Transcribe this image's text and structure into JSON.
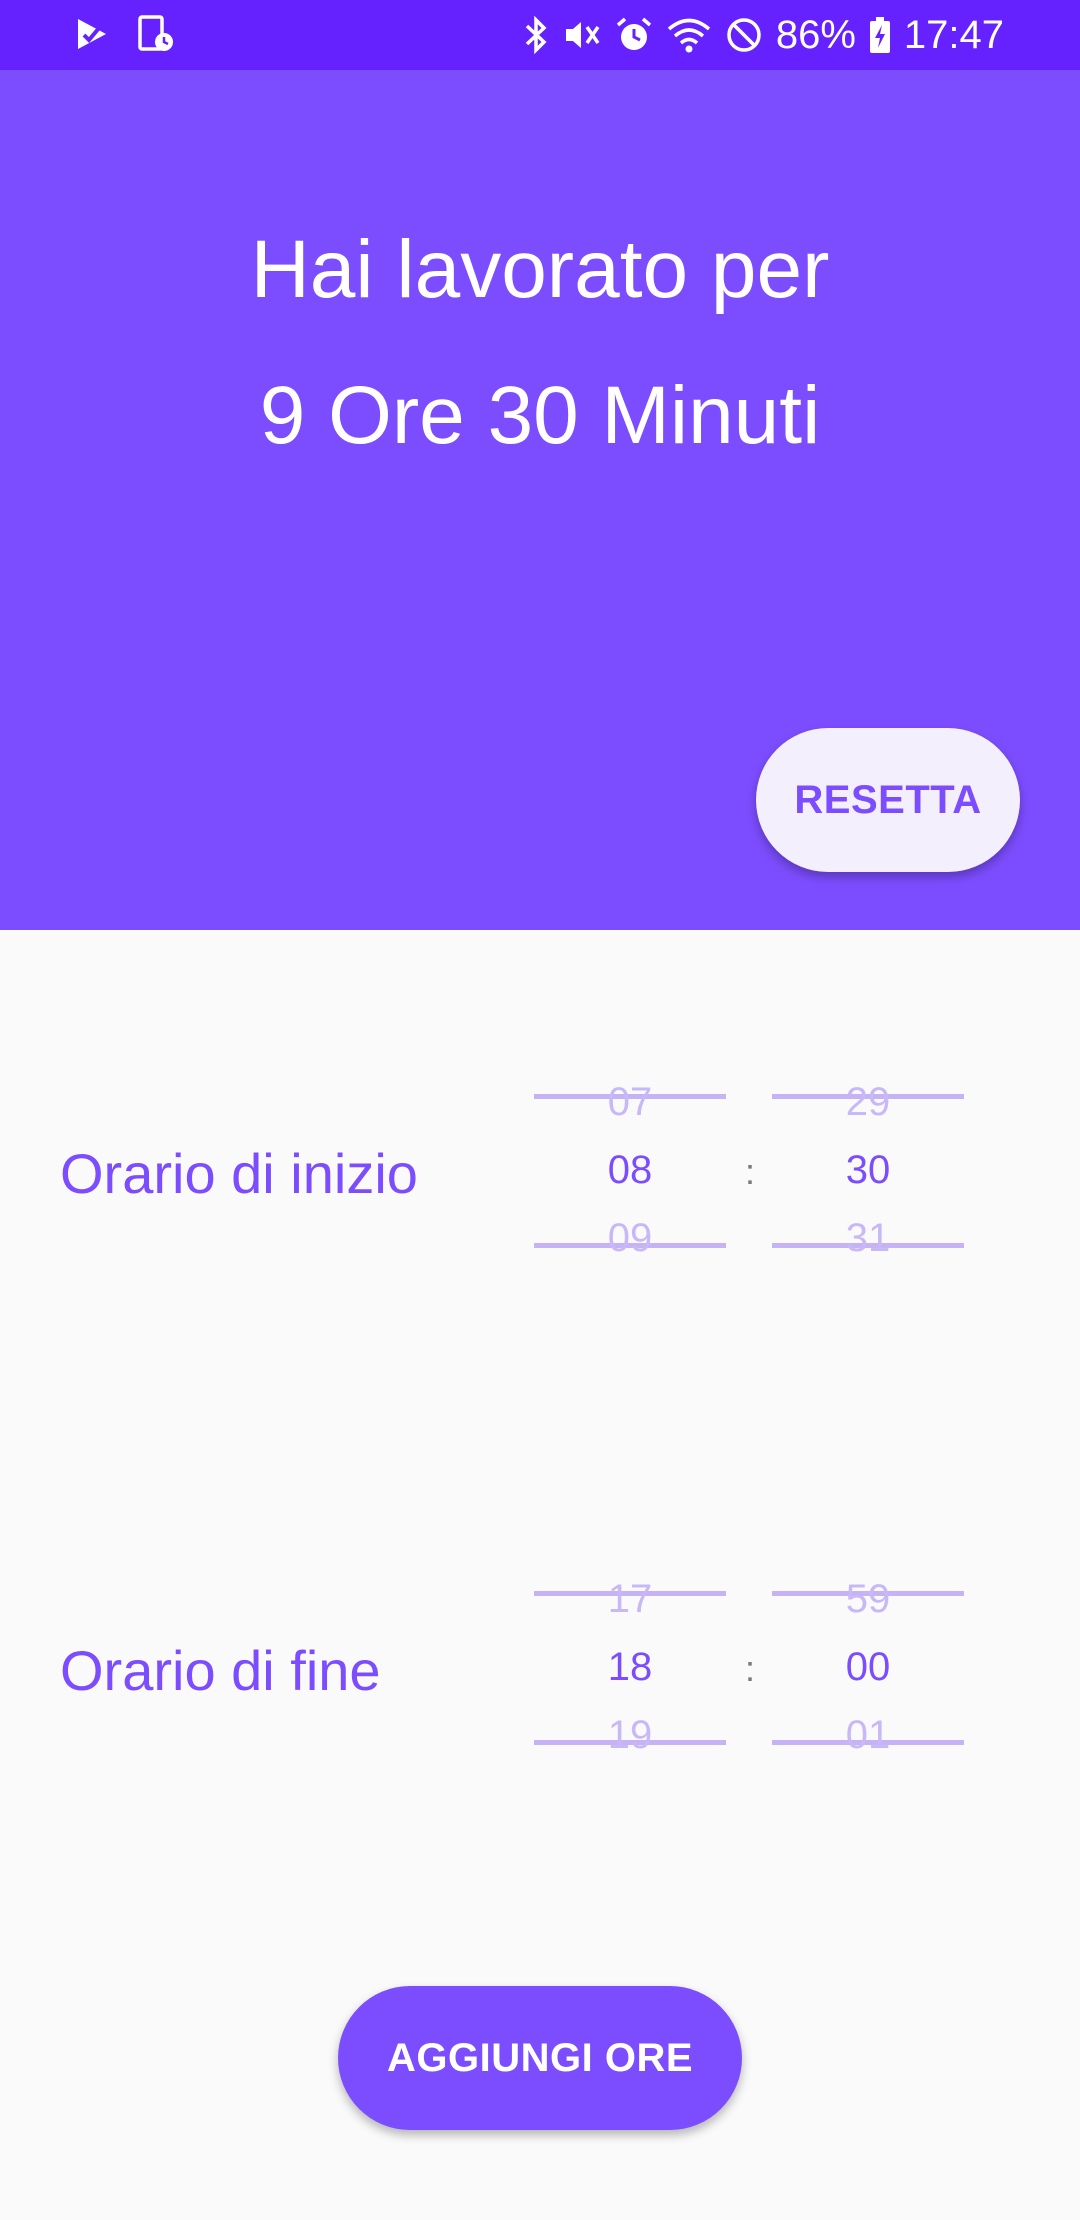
{
  "status_bar": {
    "left_icons": [
      "play-store-check-icon",
      "screen-timer-icon"
    ],
    "right_icons": [
      "bluetooth-icon",
      "mute-icon",
      "alarm-icon",
      "wifi-icon",
      "do-not-disturb-icon",
      "battery-charging-icon"
    ],
    "battery": "86%",
    "time": "17:47"
  },
  "header": {
    "line1": "Hai lavorato per",
    "line2": "9 Ore 30 Minuti",
    "reset_label": "RESETTA"
  },
  "start": {
    "label": "Orario di inizio",
    "hours": {
      "prev": "07",
      "current": "08",
      "next": "09"
    },
    "minutes": {
      "prev": "29",
      "current": "30",
      "next": "31"
    },
    "separator": ":"
  },
  "end": {
    "label": "Orario di fine",
    "hours": {
      "prev": "17",
      "current": "18",
      "next": "19"
    },
    "minutes": {
      "prev": "59",
      "current": "00",
      "next": "01"
    },
    "separator": ":"
  },
  "add_label": "AGGIUNGI ORE",
  "colors": {
    "status_bar": "#6522ff",
    "accent": "#7c4dff",
    "background": "#fafafa",
    "reset_button_bg": "#f4effc"
  }
}
